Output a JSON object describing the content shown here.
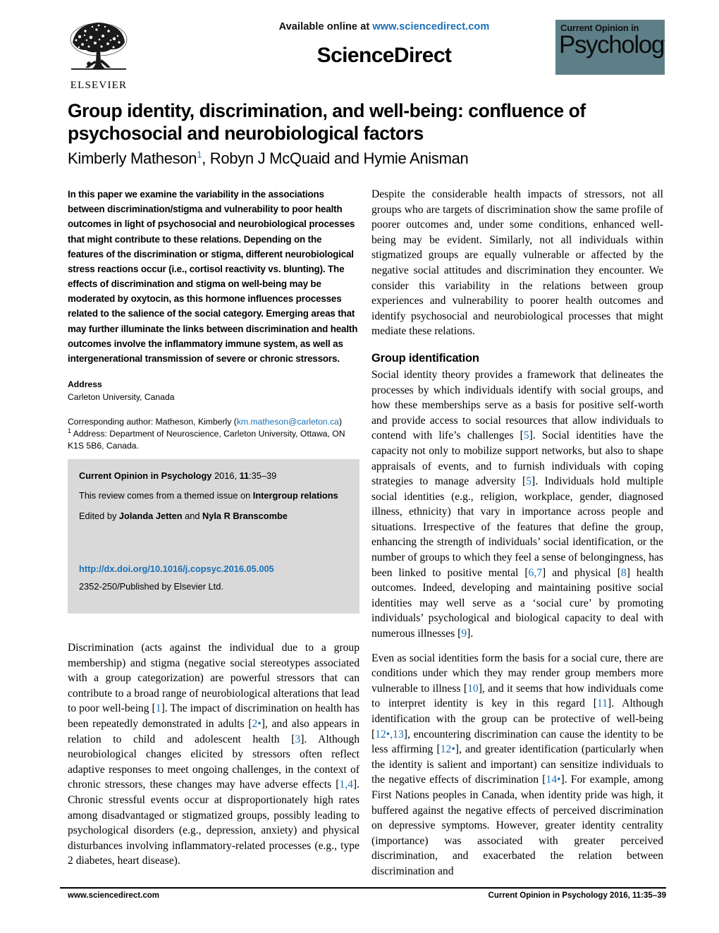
{
  "header": {
    "available_online_prefix": "Available online at ",
    "sciencedirect_url": "www.sciencedirect.com",
    "sciencedirect_logo": "ScienceDirect",
    "publisher_wordmark": "ELSEVIER",
    "journal_badge_line1": "Current Opinion in",
    "journal_badge_line2": "Psychology",
    "badge_bg_color": "#5e7f87",
    "link_color": "#1a6fb5"
  },
  "article": {
    "title": "Group identity, discrimination, and well-being: confluence of psychosocial and neurobiological factors",
    "authors_part1": "Kimberly Matheson",
    "authors_footnote_marker": "1",
    "authors_part2": ", Robyn J McQuaid and Hymie Anisman"
  },
  "abstract": {
    "text": "In this paper we examine the variability in the associations between discrimination/stigma and vulnerability to poor health outcomes in light of psychosocial and neurobiological processes that might contribute to these relations. Depending on the features of the discrimination or stigma, different neurobiological stress reactions occur (i.e., cortisol reactivity vs. blunting). The effects of discrimination and stigma on well-being may be moderated by oxytocin, as this hormone influences processes related to the salience of the social category. Emerging areas that may further illuminate the links between discrimination and health outcomes involve the inflammatory immune system, as well as intergenerational transmission of severe or chronic stressors."
  },
  "address": {
    "heading": "Address",
    "affiliation": "Carleton University, Canada",
    "corresponding_prefix": "Corresponding author: Matheson, Kimberly (",
    "corresponding_email": "km.matheson@carleton.ca",
    "corresponding_suffix": ")",
    "footnote_marker": "1",
    "footnote_text": " Address: Department of Neuroscience, Carleton University, Ottawa, ON K1S 5B6, Canada."
  },
  "journal_box": {
    "citation_journal": "Current Opinion in Psychology",
    "citation_year": " 2016, ",
    "citation_volume": "11",
    "citation_pages": ":35–39",
    "themed_issue_prefix": "This review comes from a themed issue on ",
    "themed_issue_name": "Intergroup relations",
    "edited_by_prefix": "Edited by ",
    "editor_1": "Jolanda Jetten",
    "edited_by_joiner": " and ",
    "editor_2": "Nyla R Branscombe",
    "doi": "http://dx.doi.org/10.1016/j.copsyc.2016.05.005",
    "issn_line": "2352-250/Published by Elsevier Ltd."
  },
  "body": {
    "left_para_1_a": "Discrimination (acts against the individual due to a group membership) and stigma (negative social stereotypes associated with a group categorization) are powerful stressors that can contribute to a broad range of neurobiological alterations that lead to poor well-being [",
    "left_para_1_ref1": "1",
    "left_para_1_b": "]. The impact of discrimination on health has been repeatedly demonstrated in adults [",
    "left_para_1_ref2": "2•",
    "left_para_1_c": "], and also appears in relation to child and adolescent health [",
    "left_para_1_ref3": "3",
    "left_para_1_d": "]. Although neurobiological changes elicited by stressors often reflect adaptive responses to meet ongoing challenges, in the context of chronic stressors, these changes may have adverse effects [",
    "left_para_1_ref4": "1,4",
    "left_para_1_e": "]. Chronic stressful events occur at disproportionately high rates among disadvantaged or stigmatized groups, possibly leading to psychological disorders (e.g., depression, anxiety) and physical disturbances involving inflammatory-related processes (e.g., type 2 diabetes, heart disease).",
    "right_para_1": "Despite the considerable health impacts of stressors, not all groups who are targets of discrimination show the same profile of poorer outcomes and, under some conditions, enhanced well-being may be evident. Similarly, not all individuals within stigmatized groups are equally vulnerable or affected by the negative social attitudes and discrimination they encounter. We consider this variability in the relations between group experiences and vulnerability to poorer health outcomes and identify psychosocial and neurobiological processes that might mediate these relations.",
    "section_heading_1": "Group identification",
    "right_para_2_a": "Social identity theory provides a framework that delineates the processes by which individuals identify with social groups, and how these memberships serve as a basis for positive self-worth and provide access to social resources that allow individuals to contend with life’s challenges [",
    "right_para_2_ref1": "5",
    "right_para_2_b": "]. Social identities have the capacity not only to mobilize support networks, but also to shape appraisals of events, and to furnish individuals with coping strategies to manage adversity [",
    "right_para_2_ref2": "5",
    "right_para_2_c": "]. Individuals hold multiple social identities (e.g., religion, workplace, gender, diagnosed illness, ethnicity) that vary in importance across people and situations. Irrespective of the features that define the group, enhancing the strength of individuals’ social identification, or the number of groups to which they feel a sense of belongingness, has been linked to positive mental [",
    "right_para_2_ref3": "6,7",
    "right_para_2_d": "] and physical [",
    "right_para_2_ref4": "8",
    "right_para_2_e": "] health outcomes. Indeed, developing and maintaining positive social identities may well serve as a ‘social cure’ by promoting individuals’ psychological and biological capacity to deal with numerous illnesses [",
    "right_para_2_ref5": "9",
    "right_para_2_f": "].",
    "right_para_3_a": "Even as social identities form the basis for a social cure, there are conditions under which they may render group members more vulnerable to illness [",
    "right_para_3_ref1": "10",
    "right_para_3_b": "], and it seems that how individuals come to interpret identity is key in this regard [",
    "right_para_3_ref2": "11",
    "right_para_3_c": "]. Although identification with the group can be protective of well-being [",
    "right_para_3_ref3": "12•,13",
    "right_para_3_d": "], encountering discrimination can cause the identity to be less affirming [",
    "right_para_3_ref4": "12•",
    "right_para_3_e": "], and greater identification (particularly when the identity is salient and important) can sensitize individuals to the negative effects of discrimination [",
    "right_para_3_ref5": "14•",
    "right_para_3_f": "]. For example, among First Nations peoples in Canada, when identity pride was high, it buffered against the negative effects of perceived discrimination on depressive symptoms. However, greater identity centrality (importance) was associated with greater perceived discrimination, and exacerbated the relation between discrimination and"
  },
  "footer": {
    "left": "www.sciencedirect.com",
    "right_journal": "Current Opinion in Psychology",
    "right_citation": " 2016, 11:35–39"
  }
}
